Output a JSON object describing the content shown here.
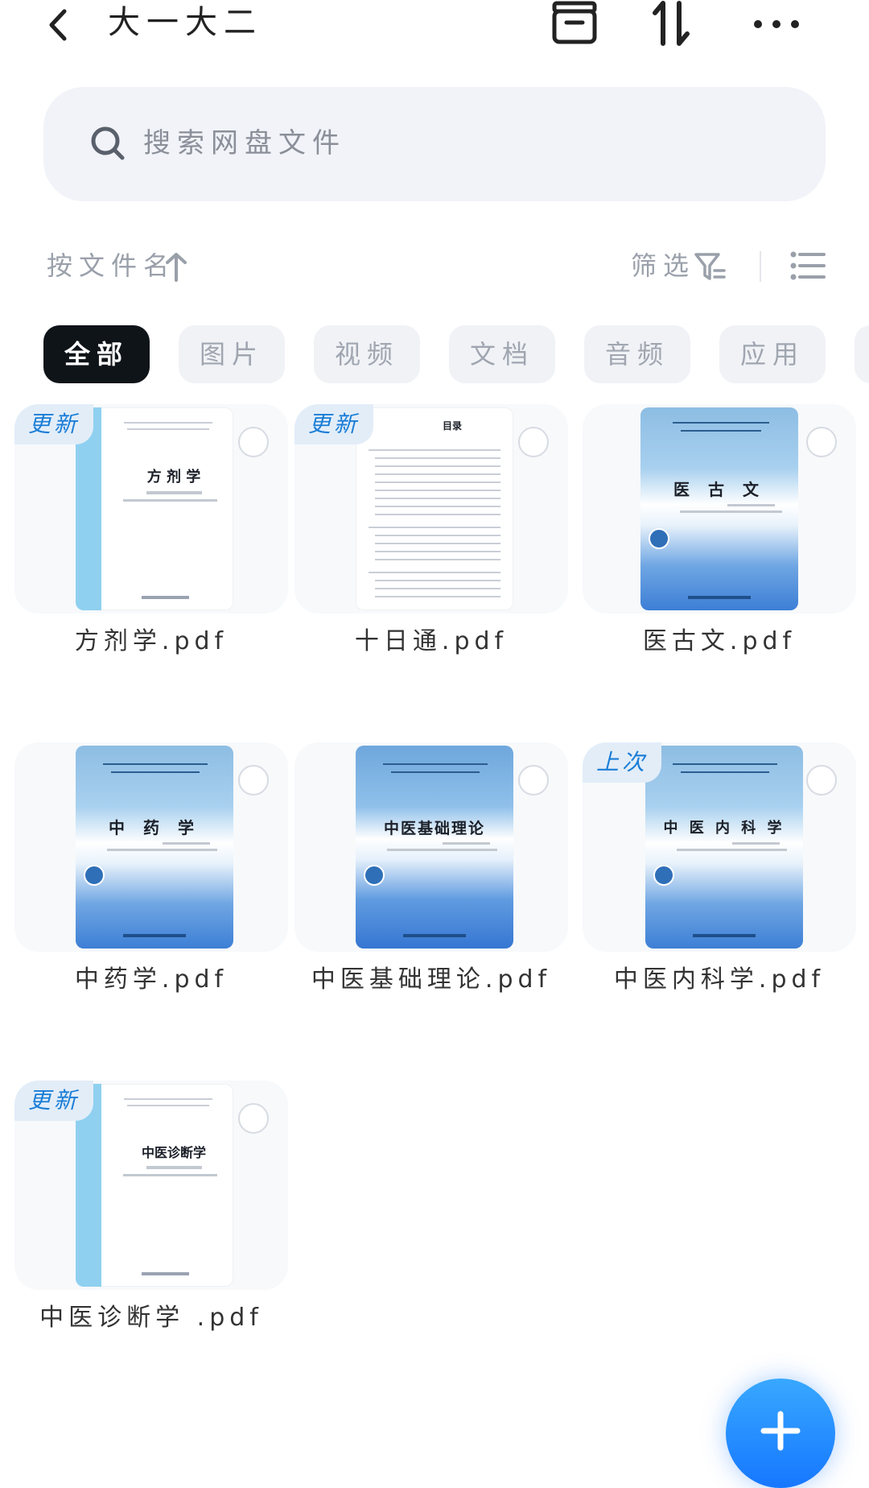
{
  "header": {
    "title": "大一大二",
    "icons": [
      "back-arrow-icon",
      "archive-icon",
      "sort-icon",
      "more-icon"
    ]
  },
  "search": {
    "placeholder": "搜索网盘文件"
  },
  "sortbar": {
    "sort_label": "按文件名",
    "filter_label": "筛选"
  },
  "categories": [
    {
      "label": "全部",
      "active": true
    },
    {
      "label": "图片",
      "active": false
    },
    {
      "label": "视频",
      "active": false
    },
    {
      "label": "文档",
      "active": false
    },
    {
      "label": "音频",
      "active": false
    },
    {
      "label": "应用",
      "active": false
    }
  ],
  "files": [
    {
      "name": "方剂学.pdf",
      "badge": "更新",
      "cover_title": "方 剂 学",
      "style": "white"
    },
    {
      "name": "十日通.pdf",
      "badge": "更新",
      "cover_title": "目录",
      "style": "toc"
    },
    {
      "name": "医古文.pdf",
      "badge": "",
      "cover_title": "医 古 文",
      "style": "blue"
    },
    {
      "name": "中药学.pdf",
      "badge": "",
      "cover_title": "中 药 学",
      "style": "blue"
    },
    {
      "name": "中医基础理论.pdf",
      "badge": "",
      "cover_title": "中医基础理论",
      "style": "blue"
    },
    {
      "name": "中医内科学.pdf",
      "badge": "上次",
      "cover_title": "中 医 内 科 学",
      "style": "blue"
    },
    {
      "name": "中医诊断学 .pdf",
      "badge": "更新",
      "cover_title": "中医诊断学",
      "style": "white"
    }
  ],
  "colors": {
    "accent": "#1677ff",
    "badge_text": "#1a7dd6",
    "chip_active": "#0f1419"
  }
}
